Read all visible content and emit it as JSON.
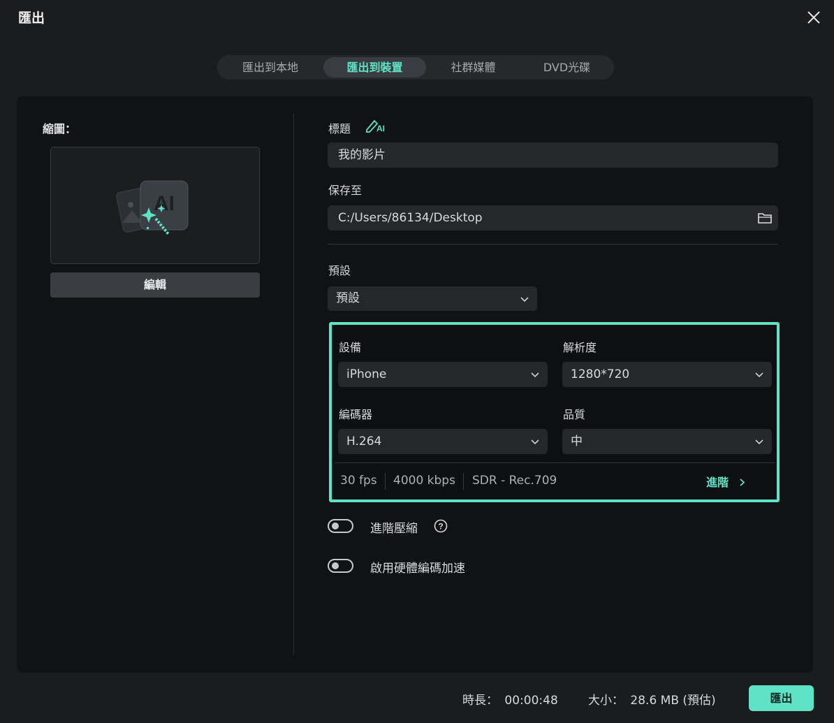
{
  "window": {
    "title": "匯出"
  },
  "tabs": [
    {
      "label": "匯出到本地",
      "active": false
    },
    {
      "label": "匯出到裝置",
      "active": true
    },
    {
      "label": "社群媒體",
      "active": false
    },
    {
      "label": "DVD光碟",
      "active": false
    }
  ],
  "thumbnail": {
    "label": "縮圖：",
    "edit_label": "編輯"
  },
  "form": {
    "title_label": "標題",
    "ai_badge": "AI",
    "title_value": "我的影片",
    "save_label": "保存至",
    "save_path": "C:/Users/86134/Desktop",
    "preset_label": "預設",
    "preset_value": "預設"
  },
  "device_settings": {
    "device_label": "設備",
    "device_value": "iPhone",
    "resolution_label": "解析度",
    "resolution_value": "1280*720",
    "encoder_label": "編碼器",
    "encoder_value": "H.264",
    "quality_label": "品質",
    "quality_value": "中",
    "fps": "30 fps",
    "bitrate": "4000 kbps",
    "color": "SDR - Rec.709",
    "advanced_label": "進階"
  },
  "toggles": {
    "compression_label": "進階壓縮",
    "hw_accel_label": "啟用硬體編碼加速",
    "compression_on": false,
    "hw_accel_on": false
  },
  "footer": {
    "duration_label": "時長：",
    "duration_value": "00:00:48",
    "size_label": "大小：",
    "size_value": "28.6 MB (預估)",
    "export_label": "匯出"
  },
  "colors": {
    "accent": "#5fe3c6",
    "background": "#1b1c1e",
    "panel": "#111213"
  }
}
